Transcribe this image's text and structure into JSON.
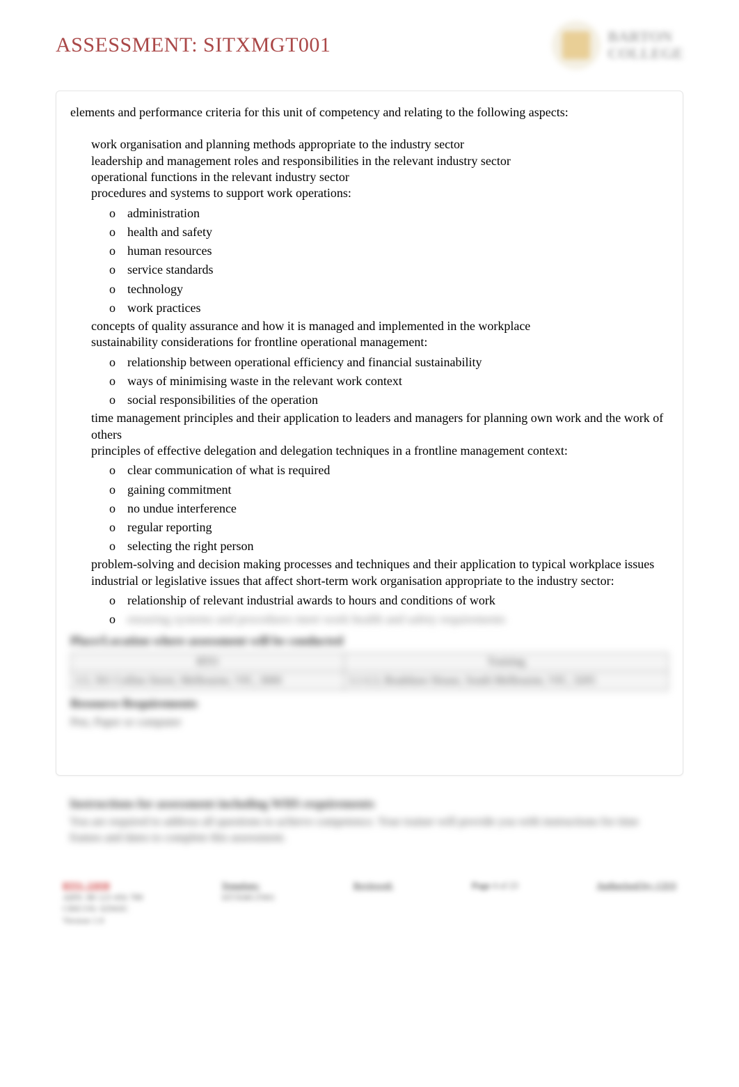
{
  "header": {
    "title": "ASSESSMENT: SITXMGT001",
    "logo_line1": "BARTON",
    "logo_line2": "COLLEGE"
  },
  "content": {
    "intro": "elements and performance criteria for this unit of competency and relating to the following aspects:",
    "items": [
      {
        "text": "work organisation and planning methods appropriate to the industry sector"
      },
      {
        "text": "leadership and management roles and responsibilities in the relevant industry sector"
      },
      {
        "text": "operational functions in the relevant industry sector"
      },
      {
        "text": "procedures and systems to support work operations:",
        "sub": [
          "administration",
          "health and safety",
          "human resources",
          "service standards",
          "technology",
          "work practices"
        ]
      },
      {
        "text": "concepts of quality assurance and how it is managed and implemented in the workplace"
      },
      {
        "text": "sustainability considerations for frontline operational management:",
        "sub": [
          "relationship between operational efficiency and financial sustainability",
          "ways of minimising waste in the relevant work context",
          "social responsibilities of the operation"
        ]
      },
      {
        "text": "time management principles and their application to leaders and managers for planning own work and the work of others"
      },
      {
        "text": "principles of effective delegation and delegation techniques in a frontline management context:",
        "sub": [
          "clear communication of what is required",
          "gaining commitment",
          "no undue interference",
          "regular reporting",
          "selecting the right person"
        ]
      },
      {
        "text": "problem-solving and decision making processes and techniques and their application to typical workplace issues"
      },
      {
        "text": "industrial or legislative issues that affect short-term work organisation appropriate to the industry sector:",
        "sub": [
          "relationship of relevant industrial awards to hours and conditions of work"
        ],
        "sub_blurred": [
          "ensuring systems and procedures meet work health and safety requirements"
        ]
      }
    ]
  },
  "blurred": {
    "place_heading": "Place/Location where assessment will be conducted",
    "col1": "RTO",
    "col2": "Training",
    "addr1": "L5, 501 Collins Street, Melbourne, VIC, 3000",
    "addr2": "L1-L3, Bradshaw House, South Melbourne, VIC, 3205",
    "resource_heading": "Resource Requirements",
    "resource_body": "Pen, Paper or computer",
    "instructions_heading": "Instructions for assessment including WHS requirements",
    "instructions_body": "You are required to address all questions to achieve competence. Your trainer will provide you with instructions for time frames and dates to complete this assessment."
  },
  "footer": {
    "col1_line1": "RTO: 22030",
    "col1_line2": "ABN: 88 123 456 789",
    "col1_line3": "CRICOS: 02943C",
    "col1_line4": "Version 1.0",
    "col2_line1": "Template:",
    "col2_line2": "SITXMGT001",
    "col3_line1": "Reviewed:",
    "col3_line2": "",
    "page_label": "Page",
    "page_value": "4 of 23",
    "col5": "Authorised by: CEO"
  }
}
